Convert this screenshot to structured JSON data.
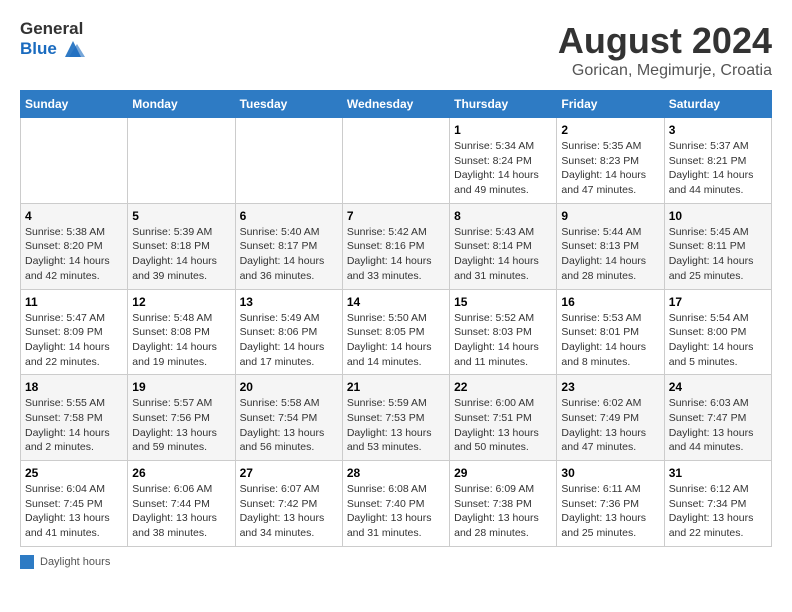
{
  "logo": {
    "general": "General",
    "blue": "Blue"
  },
  "title": "August 2024",
  "subtitle": "Gorican, Megimurje, Croatia",
  "days_of_week": [
    "Sunday",
    "Monday",
    "Tuesday",
    "Wednesday",
    "Thursday",
    "Friday",
    "Saturday"
  ],
  "weeks": [
    [
      {
        "day": "",
        "detail": ""
      },
      {
        "day": "",
        "detail": ""
      },
      {
        "day": "",
        "detail": ""
      },
      {
        "day": "",
        "detail": ""
      },
      {
        "day": "1",
        "detail": "Sunrise: 5:34 AM\nSunset: 8:24 PM\nDaylight: 14 hours\nand 49 minutes."
      },
      {
        "day": "2",
        "detail": "Sunrise: 5:35 AM\nSunset: 8:23 PM\nDaylight: 14 hours\nand 47 minutes."
      },
      {
        "day": "3",
        "detail": "Sunrise: 5:37 AM\nSunset: 8:21 PM\nDaylight: 14 hours\nand 44 minutes."
      }
    ],
    [
      {
        "day": "4",
        "detail": "Sunrise: 5:38 AM\nSunset: 8:20 PM\nDaylight: 14 hours\nand 42 minutes."
      },
      {
        "day": "5",
        "detail": "Sunrise: 5:39 AM\nSunset: 8:18 PM\nDaylight: 14 hours\nand 39 minutes."
      },
      {
        "day": "6",
        "detail": "Sunrise: 5:40 AM\nSunset: 8:17 PM\nDaylight: 14 hours\nand 36 minutes."
      },
      {
        "day": "7",
        "detail": "Sunrise: 5:42 AM\nSunset: 8:16 PM\nDaylight: 14 hours\nand 33 minutes."
      },
      {
        "day": "8",
        "detail": "Sunrise: 5:43 AM\nSunset: 8:14 PM\nDaylight: 14 hours\nand 31 minutes."
      },
      {
        "day": "9",
        "detail": "Sunrise: 5:44 AM\nSunset: 8:13 PM\nDaylight: 14 hours\nand 28 minutes."
      },
      {
        "day": "10",
        "detail": "Sunrise: 5:45 AM\nSunset: 8:11 PM\nDaylight: 14 hours\nand 25 minutes."
      }
    ],
    [
      {
        "day": "11",
        "detail": "Sunrise: 5:47 AM\nSunset: 8:09 PM\nDaylight: 14 hours\nand 22 minutes."
      },
      {
        "day": "12",
        "detail": "Sunrise: 5:48 AM\nSunset: 8:08 PM\nDaylight: 14 hours\nand 19 minutes."
      },
      {
        "day": "13",
        "detail": "Sunrise: 5:49 AM\nSunset: 8:06 PM\nDaylight: 14 hours\nand 17 minutes."
      },
      {
        "day": "14",
        "detail": "Sunrise: 5:50 AM\nSunset: 8:05 PM\nDaylight: 14 hours\nand 14 minutes."
      },
      {
        "day": "15",
        "detail": "Sunrise: 5:52 AM\nSunset: 8:03 PM\nDaylight: 14 hours\nand 11 minutes."
      },
      {
        "day": "16",
        "detail": "Sunrise: 5:53 AM\nSunset: 8:01 PM\nDaylight: 14 hours\nand 8 minutes."
      },
      {
        "day": "17",
        "detail": "Sunrise: 5:54 AM\nSunset: 8:00 PM\nDaylight: 14 hours\nand 5 minutes."
      }
    ],
    [
      {
        "day": "18",
        "detail": "Sunrise: 5:55 AM\nSunset: 7:58 PM\nDaylight: 14 hours\nand 2 minutes."
      },
      {
        "day": "19",
        "detail": "Sunrise: 5:57 AM\nSunset: 7:56 PM\nDaylight: 13 hours\nand 59 minutes."
      },
      {
        "day": "20",
        "detail": "Sunrise: 5:58 AM\nSunset: 7:54 PM\nDaylight: 13 hours\nand 56 minutes."
      },
      {
        "day": "21",
        "detail": "Sunrise: 5:59 AM\nSunset: 7:53 PM\nDaylight: 13 hours\nand 53 minutes."
      },
      {
        "day": "22",
        "detail": "Sunrise: 6:00 AM\nSunset: 7:51 PM\nDaylight: 13 hours\nand 50 minutes."
      },
      {
        "day": "23",
        "detail": "Sunrise: 6:02 AM\nSunset: 7:49 PM\nDaylight: 13 hours\nand 47 minutes."
      },
      {
        "day": "24",
        "detail": "Sunrise: 6:03 AM\nSunset: 7:47 PM\nDaylight: 13 hours\nand 44 minutes."
      }
    ],
    [
      {
        "day": "25",
        "detail": "Sunrise: 6:04 AM\nSunset: 7:45 PM\nDaylight: 13 hours\nand 41 minutes."
      },
      {
        "day": "26",
        "detail": "Sunrise: 6:06 AM\nSunset: 7:44 PM\nDaylight: 13 hours\nand 38 minutes."
      },
      {
        "day": "27",
        "detail": "Sunrise: 6:07 AM\nSunset: 7:42 PM\nDaylight: 13 hours\nand 34 minutes."
      },
      {
        "day": "28",
        "detail": "Sunrise: 6:08 AM\nSunset: 7:40 PM\nDaylight: 13 hours\nand 31 minutes."
      },
      {
        "day": "29",
        "detail": "Sunrise: 6:09 AM\nSunset: 7:38 PM\nDaylight: 13 hours\nand 28 minutes."
      },
      {
        "day": "30",
        "detail": "Sunrise: 6:11 AM\nSunset: 7:36 PM\nDaylight: 13 hours\nand 25 minutes."
      },
      {
        "day": "31",
        "detail": "Sunrise: 6:12 AM\nSunset: 7:34 PM\nDaylight: 13 hours\nand 22 minutes."
      }
    ]
  ],
  "legend": {
    "daylight_hours": "Daylight hours"
  }
}
